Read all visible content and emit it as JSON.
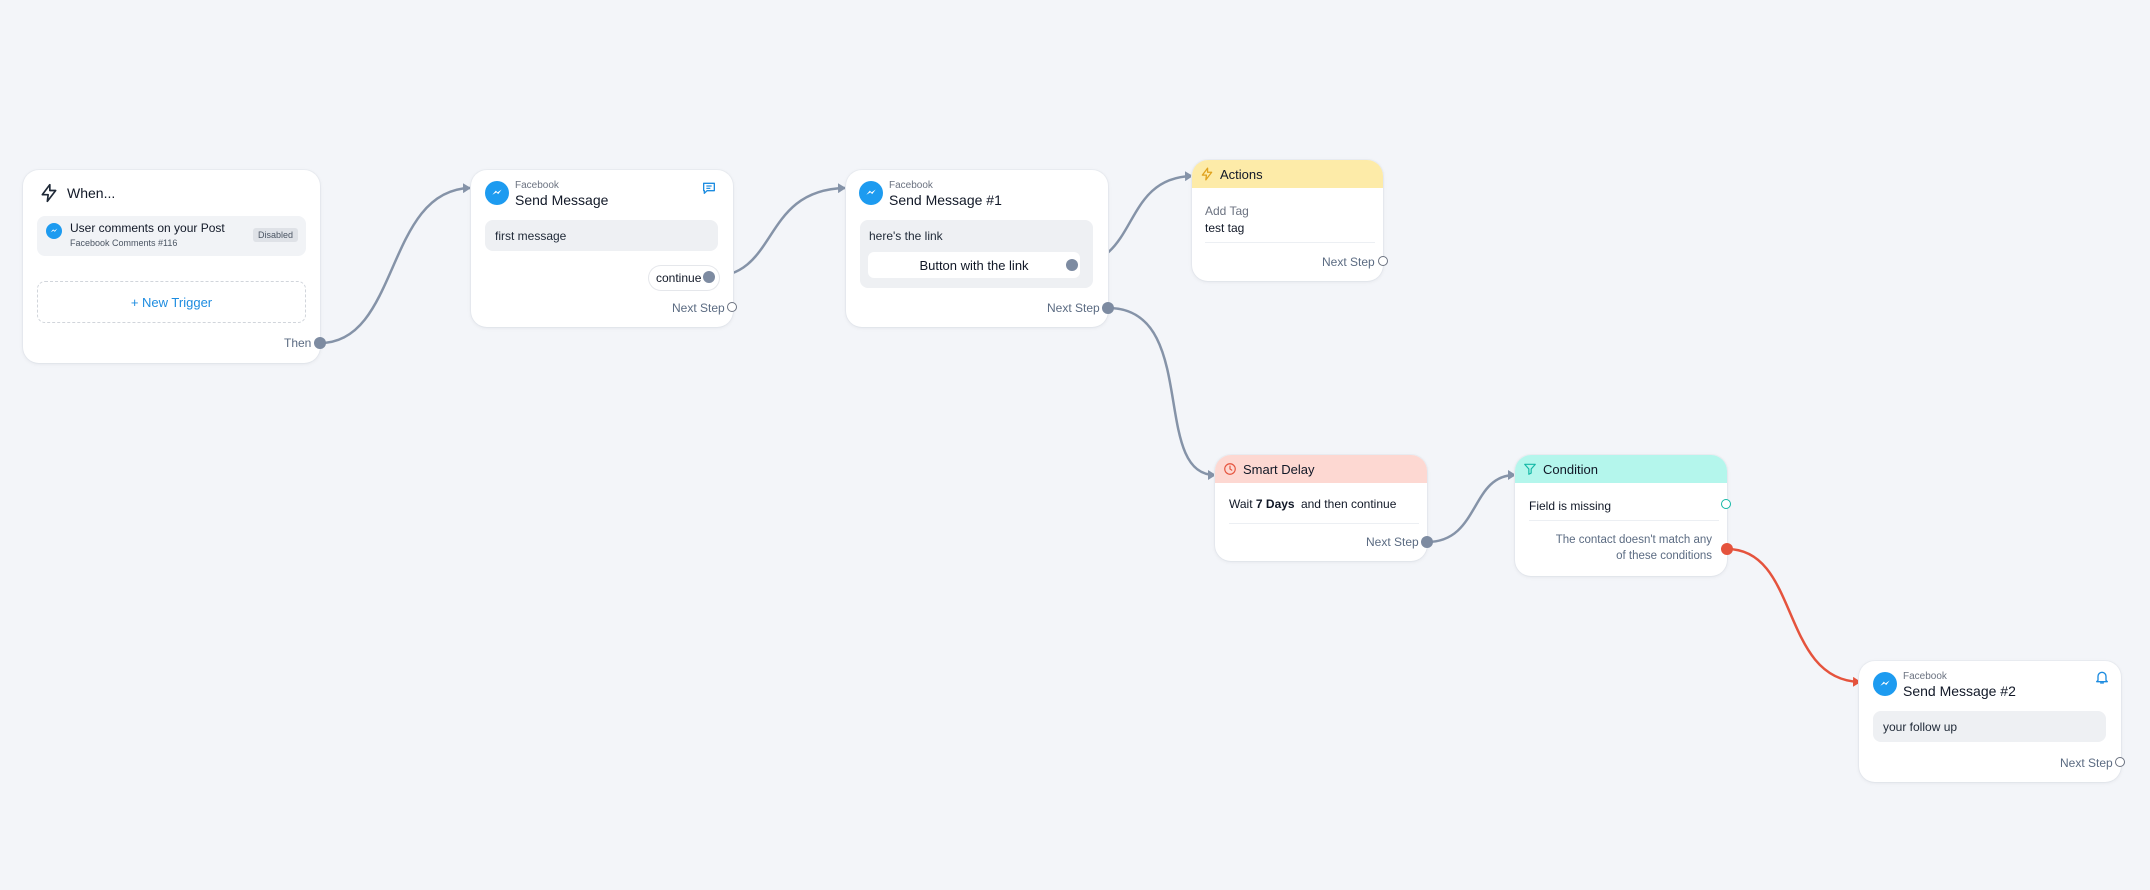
{
  "trigger": {
    "title": "When...",
    "item_title": "User comments on your Post",
    "item_subtitle": "Facebook Comments #116",
    "badge": "Disabled",
    "new_trigger": "+ New Trigger",
    "then_label": "Then"
  },
  "send_message": {
    "platform": "Facebook",
    "title": "Send Message",
    "message": "first message",
    "button_label": "continue",
    "next_step": "Next Step"
  },
  "send_message_1": {
    "platform": "Facebook",
    "title": "Send Message #1",
    "message": "here's the link",
    "button_label": "Button with the link",
    "next_step": "Next Step"
  },
  "actions": {
    "title": "Actions",
    "action_type": "Add Tag",
    "action_value": "test tag",
    "next_step": "Next Step"
  },
  "smart_delay": {
    "title": "Smart Delay",
    "prefix": "Wait",
    "duration": "7 Days",
    "suffix": "and then continue",
    "next_step": "Next Step"
  },
  "condition": {
    "title": "Condition",
    "rule": "Field is missing",
    "else_text_line1": "The contact doesn't match any",
    "else_text_line2": "of these conditions"
  },
  "send_message_2": {
    "platform": "Facebook",
    "title": "Send Message #2",
    "message": "your follow up",
    "next_step": "Next Step"
  },
  "colors": {
    "edge": "#8593a8",
    "edge_else": "#e5533d",
    "link_blue": "#1d8ce0",
    "actions_header": "#fdeba8",
    "delay_header": "#fdd8d2",
    "condition_header": "#b4f6ec"
  },
  "icons": [
    "bolt-icon",
    "messenger-icon",
    "chat-bubble-icon",
    "bell-icon",
    "actions-bolt-icon",
    "clock-icon",
    "filter-icon"
  ]
}
